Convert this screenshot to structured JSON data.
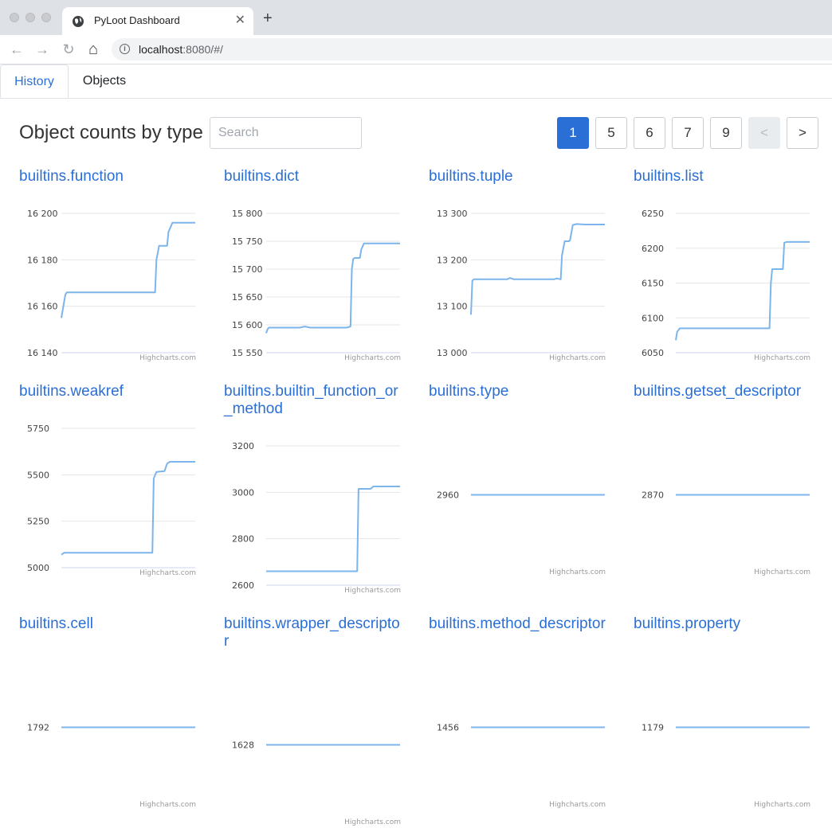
{
  "browser": {
    "tab_title": "PyLoot Dashboard",
    "tab_close": "✕",
    "new_tab": "+",
    "url_host": "localhost",
    "url_rest": ":8080/#/",
    "back_icon": "←",
    "forward_icon": "→",
    "reload_icon": "↻",
    "home_icon": "⌂",
    "info_icon": "i"
  },
  "nav": {
    "tabs": [
      {
        "label": "History",
        "active": true
      },
      {
        "label": "Objects",
        "active": false
      }
    ]
  },
  "header": {
    "title": "Object counts by type",
    "search_placeholder": "Search"
  },
  "pagination": {
    "pages": [
      "1",
      "5",
      "6",
      "7",
      "9"
    ],
    "active": "1",
    "prev": "<",
    "next": ">"
  },
  "chart_credit": "Highcharts.com",
  "colors": {
    "accent": "#2a6fd6",
    "series": "#7cb5ec"
  },
  "chart_data": [
    {
      "type": "line",
      "title": "builtins.function",
      "yticks": [
        "16 140",
        "16 160",
        "16 180",
        "16 200"
      ],
      "ylim": [
        16140,
        16200
      ],
      "x": [
        0,
        0.03,
        0.04,
        0.7,
        0.71,
        0.73,
        0.79,
        0.8,
        0.83,
        1.0
      ],
      "y": [
        16155,
        16165,
        16166,
        16166,
        16180,
        16186,
        16186,
        16192,
        16196,
        16196
      ]
    },
    {
      "type": "line",
      "title": "builtins.dict",
      "yticks": [
        "15 550",
        "15 600",
        "15 650",
        "15 700",
        "15 750",
        "15 800"
      ],
      "ylim": [
        15550,
        15800
      ],
      "x": [
        0,
        0.01,
        0.02,
        0.25,
        0.29,
        0.33,
        0.6,
        0.63,
        0.64,
        0.65,
        0.66,
        0.7,
        0.71,
        0.73,
        1.0
      ],
      "y": [
        15585,
        15592,
        15595,
        15595,
        15597,
        15595,
        15595,
        15597,
        15700,
        15718,
        15720,
        15720,
        15735,
        15746,
        15746
      ]
    },
    {
      "type": "line",
      "title": "builtins.tuple",
      "yticks": [
        "13 000",
        "13 100",
        "13 200",
        "13 300"
      ],
      "ylim": [
        13000,
        13300
      ],
      "x": [
        0,
        0.01,
        0.02,
        0.27,
        0.29,
        0.32,
        0.62,
        0.64,
        0.67,
        0.68,
        0.7,
        0.73,
        0.74,
        0.76,
        0.79,
        0.85,
        1.0
      ],
      "y": [
        13082,
        13155,
        13158,
        13158,
        13161,
        13158,
        13158,
        13160,
        13158,
        13210,
        13240,
        13240,
        13242,
        13275,
        13277,
        13276,
        13276
      ]
    },
    {
      "type": "line",
      "title": "builtins.list",
      "yticks": [
        "6050",
        "6100",
        "6150",
        "6200",
        "6250"
      ],
      "ylim": [
        6050,
        6250
      ],
      "x": [
        0,
        0.01,
        0.03,
        0.7,
        0.71,
        0.72,
        0.8,
        0.81,
        0.83,
        0.87,
        1.0
      ],
      "y": [
        6068,
        6080,
        6085,
        6085,
        6150,
        6170,
        6170,
        6208,
        6209,
        6209,
        6209
      ]
    },
    {
      "type": "line",
      "title": "builtins.weakref",
      "yticks": [
        "5000",
        "5250",
        "5500",
        "5750"
      ],
      "ylim": [
        5000,
        5750
      ],
      "x": [
        0,
        0.02,
        0.68,
        0.69,
        0.71,
        0.77,
        0.79,
        0.81,
        1.0
      ],
      "y": [
        5070,
        5080,
        5080,
        5480,
        5515,
        5520,
        5560,
        5570,
        5570
      ]
    },
    {
      "type": "line",
      "title": "builtins.builtin_function_or_method",
      "yticks": [
        "2600",
        "2800",
        "3000",
        "3200"
      ],
      "ylim": [
        2600,
        3200
      ],
      "x": [
        0,
        0.68,
        0.69,
        0.7,
        0.78,
        0.8,
        1.0
      ],
      "y": [
        2660,
        2660,
        3015,
        3015,
        3015,
        3025,
        3025
      ]
    },
    {
      "type": "line",
      "title": "builtins.type",
      "yticks": [
        "2960"
      ],
      "ylim": [
        2960,
        2960
      ],
      "x": [
        0,
        1
      ],
      "y": [
        2960,
        2960
      ]
    },
    {
      "type": "line",
      "title": "builtins.getset_descriptor",
      "yticks": [
        "2870"
      ],
      "ylim": [
        2870,
        2870
      ],
      "x": [
        0,
        1
      ],
      "y": [
        2870,
        2870
      ]
    },
    {
      "type": "line",
      "title": "builtins.cell",
      "yticks": [
        "1792"
      ],
      "ylim": [
        1792,
        1792
      ],
      "x": [
        0,
        1
      ],
      "y": [
        1792,
        1792
      ]
    },
    {
      "type": "line",
      "title": "builtins.wrapper_descriptor",
      "yticks": [
        "1628"
      ],
      "ylim": [
        1628,
        1628
      ],
      "x": [
        0,
        1
      ],
      "y": [
        1628,
        1628
      ]
    },
    {
      "type": "line",
      "title": "builtins.method_descriptor",
      "yticks": [
        "1456"
      ],
      "ylim": [
        1456,
        1456
      ],
      "x": [
        0,
        1
      ],
      "y": [
        1456,
        1456
      ]
    },
    {
      "type": "line",
      "title": "builtins.property",
      "yticks": [
        "1179"
      ],
      "ylim": [
        1179,
        1179
      ],
      "x": [
        0,
        1
      ],
      "y": [
        1179,
        1179
      ]
    }
  ]
}
